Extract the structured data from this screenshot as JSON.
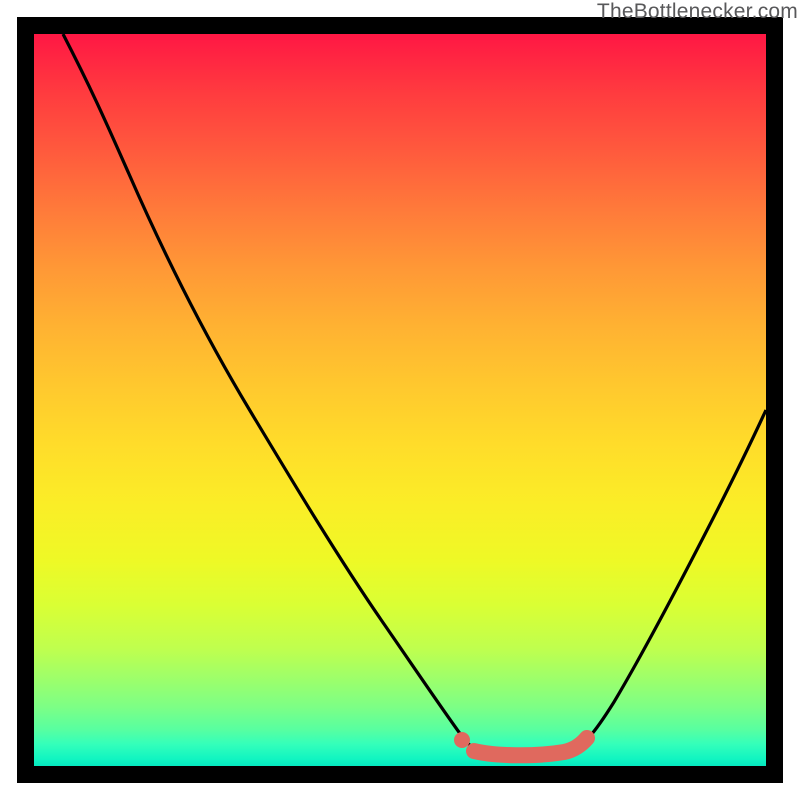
{
  "attribution": "TheBottlenecker.com",
  "colors": {
    "border": "#000000",
    "curve": "#000000",
    "marker_fill": "#e0695e",
    "marker_stroke": "#e0695e",
    "gradient_top": "#ff1744",
    "gradient_bottom": "#05e8c0"
  },
  "chart_data": {
    "type": "line",
    "title": "",
    "xlabel": "",
    "ylabel": "",
    "xlim": [
      0,
      100
    ],
    "ylim": [
      0,
      100
    ],
    "series": [
      {
        "name": "bottleneck-curve",
        "x": [
          0,
          5,
          10,
          15,
          20,
          25,
          30,
          35,
          40,
          45,
          50,
          55,
          58,
          60,
          63,
          66,
          69,
          72,
          75,
          78,
          82,
          86,
          90,
          94,
          98,
          100
        ],
        "y": [
          100,
          97,
          93,
          88,
          81,
          73,
          65,
          56,
          47,
          38,
          29,
          19,
          12,
          8,
          4,
          1,
          0.5,
          0.5,
          1,
          4,
          10,
          18,
          27,
          36,
          46,
          51
        ]
      }
    ],
    "markers": [
      {
        "name": "region-start-dot",
        "x": 58.5,
        "y": 2.5,
        "r": 1.2
      },
      {
        "name": "region-pill",
        "x0": 60,
        "x1": 73,
        "y": 1.5,
        "thickness": 2.1
      }
    ],
    "grid": false,
    "legend": false
  }
}
